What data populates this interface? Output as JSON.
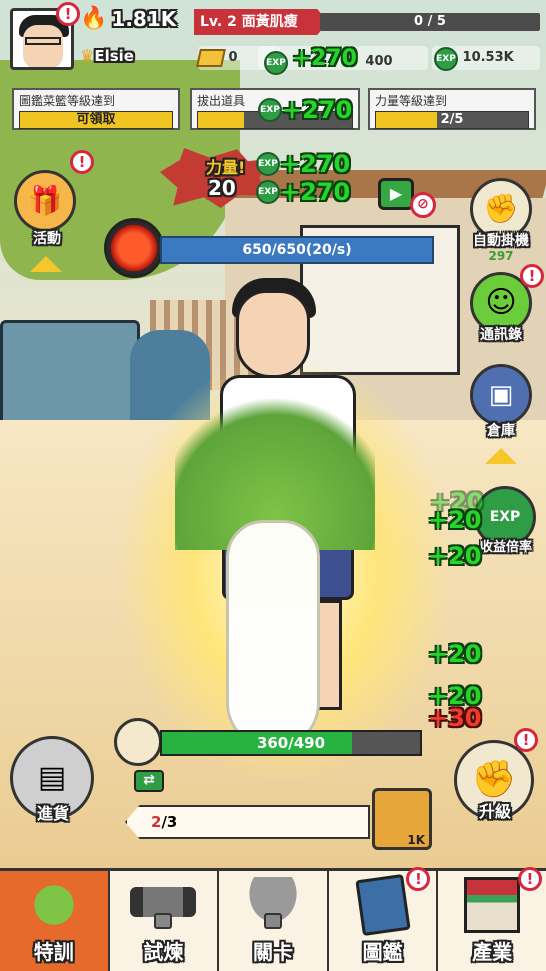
{
  "player": {
    "power": "1.81K",
    "name": "Elsie",
    "level_title": "Lv. 2 面黃肌瘦",
    "level_progress": "0 / 5",
    "level_progress_value": 0
  },
  "resources": {
    "gold": "0",
    "exp_pop": "+270",
    "exp_a": "400",
    "exp_b": "10.53K"
  },
  "quests": [
    {
      "title": "圖鑑菜籃等級達到",
      "value": "可領取",
      "fill": 1.0
    },
    {
      "title": "拔出道具",
      "value": "",
      "fill": 0.3
    },
    {
      "title": "力量等級達到",
      "value": "2/5",
      "fill": 0.4
    }
  ],
  "power_burst": {
    "label": "力量!",
    "value": "20"
  },
  "pops": {
    "quest_pop": "+270",
    "burst_pop1": "+270",
    "burst_pop2": "+270",
    "right_pops": [
      "+20",
      "+20",
      "+20",
      "+20",
      "+20"
    ],
    "red_pop": "+30"
  },
  "left_buttons": {
    "event": "活動",
    "restock": "進貨"
  },
  "right_buttons": {
    "auto": "自動掛機",
    "auto_count": "297",
    "contacts": "通訊錄",
    "storage": "倉庫",
    "income_multiplier": "收益倍率",
    "upgrade": "升級"
  },
  "hp": "650/650(20/s)",
  "pull_progress": {
    "text": "360/490",
    "value": 0.735
  },
  "quota": {
    "current": "2",
    "total": "/3"
  },
  "card": {
    "label": "1K"
  },
  "nav": [
    {
      "label": "特訓",
      "active": true
    },
    {
      "label": "試煉",
      "active": false
    },
    {
      "label": "關卡",
      "active": false
    },
    {
      "label": "圖鑑",
      "active": false
    },
    {
      "label": "產業",
      "active": false
    }
  ],
  "colors": {
    "accent": "#e56a2c",
    "hp": "#3b79c0",
    "progress": "#28b340"
  }
}
